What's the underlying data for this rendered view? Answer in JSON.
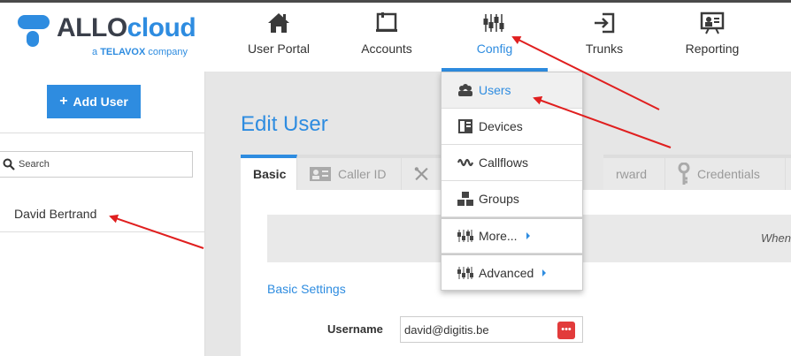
{
  "brand": {
    "name_part1": "ALLO",
    "name_part2": "cloud",
    "tagline_prefix": "a",
    "tagline_brand": "TELAVOX",
    "tagline_suffix": "company"
  },
  "nav": {
    "items": [
      {
        "label": "User Portal",
        "icon": "home-icon"
      },
      {
        "label": "Accounts",
        "icon": "accounts-icon"
      },
      {
        "label": "Config",
        "icon": "sliders-icon",
        "active": true
      },
      {
        "label": "Trunks",
        "icon": "trunk-login-icon"
      },
      {
        "label": "Reporting",
        "icon": "presentation-icon"
      }
    ]
  },
  "sidebar": {
    "add_button": "Add User",
    "search_placeholder": "Search",
    "users": [
      "David Bertrand"
    ]
  },
  "main": {
    "title": "Edit User",
    "tabs": [
      {
        "label": "Basic",
        "active": true
      },
      {
        "label": "Caller ID",
        "icon": "id-card-icon"
      },
      {
        "label": "",
        "icon": "tools-icon"
      },
      {
        "label": "rward"
      },
      {
        "label": "Credentials",
        "icon": "key-icon"
      },
      {
        "label": "",
        "icon": "briefcase-icon"
      }
    ],
    "info_text": "When",
    "section_title": "Basic Settings",
    "fields": {
      "username_label": "Username",
      "username_value": "david@digitis.be"
    }
  },
  "dropdown": {
    "items": [
      {
        "label": "Users",
        "icon": "users-icon",
        "active": true
      },
      {
        "label": "Devices",
        "icon": "devices-icon"
      },
      {
        "label": "Callflows",
        "icon": "callflows-icon"
      },
      {
        "label": "Groups",
        "icon": "groups-icon"
      },
      {
        "label": "More...",
        "icon": "sliders-icon",
        "submenu": true
      },
      {
        "label": "Advanced",
        "icon": "sliders-icon",
        "submenu": true
      }
    ]
  },
  "colors": {
    "accent": "#2e8ce0",
    "annotation_arrow": "#e01f1f",
    "password_badge": "#e23b3b"
  }
}
